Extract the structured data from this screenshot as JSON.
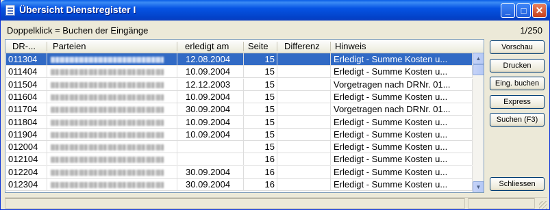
{
  "window": {
    "title": "Übersicht Dienstregister I"
  },
  "titlebar_buttons": {
    "minimize": "_",
    "maximize": "□",
    "close": "✕"
  },
  "toolbar": {
    "hint": "Doppelklick = Buchen der Eingänge",
    "counter": "1/250"
  },
  "table": {
    "columns": [
      "DR-...",
      "Parteien",
      "erledigt am",
      "Seite",
      "Differenz",
      "Hinweis"
    ],
    "selected_row": 0,
    "rows": [
      {
        "dr": "011304",
        "erledigt": "12.08.2004",
        "seite": "15",
        "differenz": "",
        "hinweis": "Erledigt - Summe Kosten u..."
      },
      {
        "dr": "011404",
        "erledigt": "10.09.2004",
        "seite": "15",
        "differenz": "",
        "hinweis": "Erledigt - Summe Kosten u..."
      },
      {
        "dr": "011504",
        "erledigt": "12.12.2003",
        "seite": "15",
        "differenz": "",
        "hinweis": "Vorgetragen nach DRNr. 01..."
      },
      {
        "dr": "011604",
        "erledigt": "10.09.2004",
        "seite": "15",
        "differenz": "",
        "hinweis": "Erledigt - Summe Kosten u..."
      },
      {
        "dr": "011704",
        "erledigt": "30.09.2004",
        "seite": "15",
        "differenz": "",
        "hinweis": "Vorgetragen nach DRNr. 01..."
      },
      {
        "dr": "011804",
        "erledigt": "10.09.2004",
        "seite": "15",
        "differenz": "",
        "hinweis": "Erledigt - Summe Kosten u..."
      },
      {
        "dr": "011904",
        "erledigt": "10.09.2004",
        "seite": "15",
        "differenz": "",
        "hinweis": "Erledigt - Summe Kosten u..."
      },
      {
        "dr": "012004",
        "erledigt": "",
        "seite": "15",
        "differenz": "",
        "hinweis": "Erledigt - Summe Kosten u..."
      },
      {
        "dr": "012104",
        "erledigt": "",
        "seite": "16",
        "differenz": "",
        "hinweis": "Erledigt - Summe Kosten u..."
      },
      {
        "dr": "012204",
        "erledigt": "30.09.2004",
        "seite": "16",
        "differenz": "",
        "hinweis": "Erledigt - Summe Kosten u..."
      },
      {
        "dr": "012304",
        "erledigt": "30.09.2004",
        "seite": "16",
        "differenz": "",
        "hinweis": "Erledigt - Summe Kosten u..."
      }
    ]
  },
  "buttons": {
    "vorschau": "Vorschau",
    "drucken": "Drucken",
    "eing_buchen": "Eing. buchen",
    "express": "Express",
    "suchen": "Suchen (F3)",
    "schliessen": "Schliessen"
  },
  "colors": {
    "title_bar": "#0a5ee6",
    "selection": "#316ac5",
    "window_bg": "#ece9d8"
  }
}
